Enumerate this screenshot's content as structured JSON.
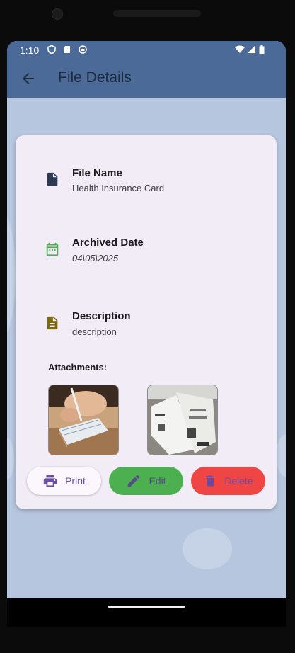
{
  "status_bar": {
    "time": "1:10"
  },
  "app_bar": {
    "title": "File Details"
  },
  "details": {
    "file_name_label": "File Name",
    "file_name_value": "Health Insurance Card",
    "archived_date_label": "Archived Date",
    "archived_date_value": "04\\05\\2025",
    "description_label": "Description",
    "description_value": "description"
  },
  "attachments": {
    "label": "Attachments:"
  },
  "actions": {
    "print": "Print",
    "edit": "Edit",
    "delete": "Delete"
  },
  "colors": {
    "app_bar": "#4c6a97",
    "background": "#b7c6df",
    "card": "#f2ecf6",
    "edit": "#4caf50",
    "delete": "#f04545",
    "accent": "#6b4fa0"
  },
  "icons": [
    "arrow-back-icon",
    "file-icon",
    "calendar-icon",
    "description-icon",
    "printer-icon",
    "pencil-icon",
    "trash-icon"
  ]
}
